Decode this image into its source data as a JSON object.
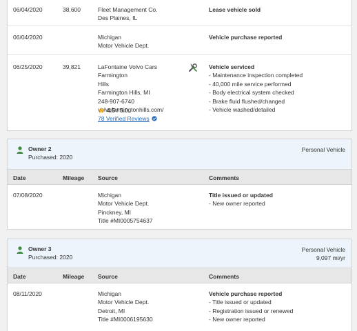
{
  "top_card": {
    "rows": [
      {
        "date": "06/04/2020",
        "mileage": "38,600",
        "source": [
          "Fleet Management Co.",
          "Des Plaines, IL"
        ],
        "comments_title": "Lease vehicle sold",
        "comments": []
      },
      {
        "date": "06/04/2020",
        "mileage": "",
        "source": [
          "Michigan",
          "Motor Vehicle Dept."
        ],
        "comments_title": "Vehicle purchase reported",
        "comments": []
      },
      {
        "date": "06/25/2020",
        "mileage": "39,821",
        "source": [
          "LaFontaine Volvo Cars Farmington",
          "Hills",
          "Farmington Hills, MI",
          "248-907-6740",
          "volvofarmingtonhills.com/"
        ],
        "rating": "4.5 / 5.0",
        "reviews": "78 Verified Reviews",
        "service_icon": "wrench-screwdriver-icon",
        "comments_title": "Vehicle serviced",
        "comments": [
          "- Maintenance inspection completed",
          "- 40,000 mile service performed",
          "- Body electrical system checked",
          "- Brake fluid flushed/changed",
          "- Vehicle washed/detailed"
        ]
      }
    ]
  },
  "columns": {
    "date": "Date",
    "mileage": "Mileage",
    "source": "Source",
    "comments": "Comments"
  },
  "owner2": {
    "title": "Owner 2",
    "purchased": "Purchased: 2020",
    "type": "Personal Vehicle",
    "mileage_rate": "",
    "rows": [
      {
        "date": "07/08/2020",
        "mileage": "",
        "source": [
          "Michigan",
          "Motor Vehicle Dept.",
          "Pinckney, MI",
          "Title #MI0005754637"
        ],
        "comments_title": "Title issued or updated",
        "comments": [
          "- New owner reported"
        ]
      }
    ]
  },
  "owner3": {
    "title": "Owner 3",
    "purchased": "Purchased: 2020",
    "type": "Personal Vehicle",
    "mileage_rate": "9,097 mi/yr",
    "rows": [
      {
        "date": "08/11/2020",
        "mileage": "",
        "source": [
          "Michigan",
          "Motor Vehicle Dept.",
          "Detroit, MI",
          "Title #MI0006195630"
        ],
        "comments_title": "Vehicle purchase reported",
        "comments": [
          "- Title issued or updated",
          "- Registration issued or renewed",
          "- New owner reported"
        ]
      }
    ]
  },
  "colors": {
    "owner_icon": "#3c8a3c",
    "link": "#2a6bbd",
    "star": "#f2b01e",
    "verified": "#2a6bbd",
    "header_bg": "#edf4fb",
    "col_header_bg": "#e7e7e7"
  }
}
